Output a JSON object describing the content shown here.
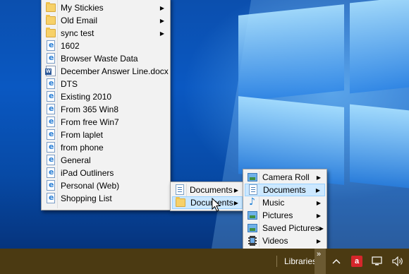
{
  "favorites_menu": {
    "items": [
      {
        "label": "My Stickies",
        "icon": "folder-icon",
        "submenu": true
      },
      {
        "label": "Old Email",
        "icon": "folder-icon",
        "submenu": true
      },
      {
        "label": "sync test",
        "icon": "folder-icon",
        "submenu": true
      },
      {
        "label": "1602",
        "icon": "ie-file-icon",
        "submenu": false
      },
      {
        "label": "Browser Waste Data",
        "icon": "ie-file-icon",
        "submenu": false
      },
      {
        "label": "December Answer Line.docx",
        "icon": "word-doc-icon",
        "submenu": false
      },
      {
        "label": "DTS",
        "icon": "ie-file-icon",
        "submenu": false
      },
      {
        "label": "Existing 2010",
        "icon": "ie-file-icon",
        "submenu": false
      },
      {
        "label": "From 365 Win8",
        "icon": "ie-file-icon",
        "submenu": false
      },
      {
        "label": "From free Win7",
        "icon": "ie-file-icon",
        "submenu": false
      },
      {
        "label": "From laplet",
        "icon": "ie-file-icon",
        "submenu": false
      },
      {
        "label": "from phone",
        "icon": "ie-file-icon",
        "submenu": false
      },
      {
        "label": "General",
        "icon": "ie-file-icon",
        "submenu": false
      },
      {
        "label": "iPad Outliners",
        "icon": "ie-file-icon",
        "submenu": false
      },
      {
        "label": "Personal (Web)",
        "icon": "ie-file-icon",
        "submenu": false
      },
      {
        "label": "Shopping List",
        "icon": "ie-file-icon",
        "submenu": false
      }
    ]
  },
  "documents_menu": {
    "items": [
      {
        "label": "Documents",
        "icon": "library-icon",
        "submenu": true,
        "highlighted": false
      },
      {
        "label": "Documents",
        "icon": "folder-icon",
        "submenu": true,
        "highlighted": true
      }
    ]
  },
  "libraries_menu": {
    "items": [
      {
        "label": "Camera Roll",
        "icon": "pictures-icon",
        "submenu": true,
        "highlighted": false
      },
      {
        "label": "Documents",
        "icon": "library-icon",
        "submenu": true,
        "highlighted": true
      },
      {
        "label": "Music",
        "icon": "music-icon",
        "submenu": true,
        "highlighted": false
      },
      {
        "label": "Pictures",
        "icon": "pictures-icon",
        "submenu": true,
        "highlighted": false
      },
      {
        "label": "Saved Pictures",
        "icon": "pictures-icon",
        "submenu": true,
        "highlighted": false
      },
      {
        "label": "Videos",
        "icon": "video-icon",
        "submenu": true,
        "highlighted": false
      }
    ]
  },
  "taskbar": {
    "toolbar_label": "Libraries",
    "chevron": "»",
    "tray_up": "^",
    "antivirus_glyph": "a",
    "volume_glyph": "🔊"
  },
  "colors": {
    "taskbar": "#4b3a12",
    "menu_bg": "#f2f2f2",
    "highlight": "#cce8ff",
    "highlight_border": "#99d1ff"
  }
}
